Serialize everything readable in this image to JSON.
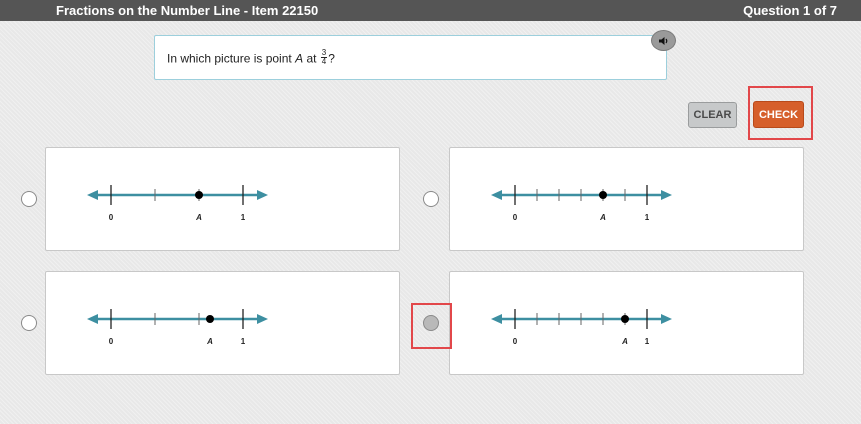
{
  "header": {
    "title": "Fractions on the Number Line - Item 22150",
    "question_counter": "Question 1 of 7"
  },
  "question": {
    "text_before": "In which picture is point",
    "point_name": "A",
    "text_at": "at",
    "fraction_numerator": "3",
    "fraction_denominator": "4",
    "text_after": "?"
  },
  "toolbar": {
    "clear_label": "CLEAR",
    "check_label": "CHECK"
  },
  "icons": {
    "audio": "speaker-icon"
  },
  "colors": {
    "number_line": "#3d8fa1",
    "check_button": "#d65f2b",
    "highlight": "#e2474a"
  },
  "options": [
    {
      "label_zero": "0",
      "label_one": "1",
      "point_label": "A",
      "divisions": 3,
      "point_position": 0.6667,
      "selected": false
    },
    {
      "label_zero": "0",
      "label_one": "1",
      "point_label": "A",
      "divisions": 6,
      "point_position": 0.6667,
      "selected": false
    },
    {
      "label_zero": "0",
      "label_one": "1",
      "point_label": "A",
      "divisions": 3,
      "point_position": 0.75,
      "selected": false
    },
    {
      "label_zero": "0",
      "label_one": "1",
      "point_label": "A",
      "divisions": 6,
      "point_position": 0.8333,
      "selected": true
    }
  ]
}
